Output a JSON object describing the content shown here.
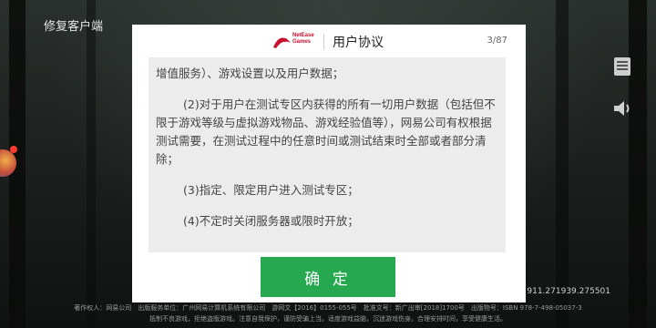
{
  "top_left": {
    "repair_label": "修复客户端"
  },
  "dialog": {
    "title": "用户协议",
    "page_counter": "3/87",
    "logo_text_1": "NetEase",
    "logo_text_2": "Games",
    "paragraphs": [
      "增值服务）、游戏设置以及用户数据；",
      "(2)对于用户在测试专区内获得的所有一切用户数据（包括但不限于游戏等级与虚拟游戏物品、游戏经验值等），网易公司有权根据测试需要，在测试过程中的任意时间或测试结束时全部或者部分清除；",
      "(3)指定、限定用户进入测试专区；",
      "(4)不定时关闭服务器或限时开放；"
    ],
    "confirm_label": "确 定",
    "prev_arrow": "‹",
    "next_arrow": "›"
  },
  "version_text": "911.271939.275501",
  "footer": {
    "line1": "著作权人：网易公司　出版服务单位：广州网易计算机系统有限公司　游网文【2016】0155-055号　批准文号：新广出审[2018]1700号　出版物号：ISBN 978-7-498-05037-3",
    "line2": "抵制不良游戏，拒绝盗版游戏。注意自我保护，谨防受骗上当。适度游戏益脑，沉迷游戏伤身。合理安排时间，享受健康生活。"
  },
  "colors": {
    "confirm_button": "#25a84f",
    "brand_red": "#c8102e",
    "content_bg": "#ececec"
  },
  "icons": {
    "side_top": "notice-board-icon",
    "side_bottom": "speaker-icon",
    "left_edge": "avatar-icon"
  }
}
